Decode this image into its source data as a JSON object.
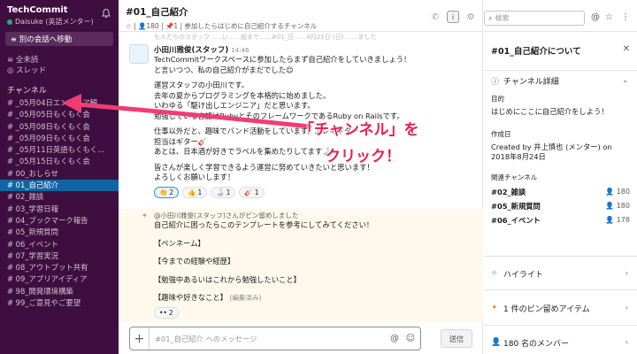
{
  "workspace": {
    "name": "TechCommit",
    "user": "Daisuke (英語メンター)"
  },
  "sidebar": {
    "jump_label": "別の会話へ移動",
    "nav": [
      "全未読",
      "スレッド"
    ],
    "section_title": "チャンネル",
    "channels": [
      "# _05月04日エンジニア観...",
      "# _05月05日もくもく会",
      "# _05月08日もくもく会",
      "# _05月09日もくもく会",
      "# _05月11日英語もくもく...",
      "# _05月15日もくもく会",
      "# 00_おしらせ",
      "# 01_自己紹介",
      "# 02_雑談",
      "# 03_学習日報",
      "# 04_ブックマーク報告",
      "# 05_新規質問",
      "# 06_イベント",
      "# 07_学習実況",
      "# 08_アウトプット共有",
      "# 09_アプリアイディア",
      "# 98_開発環境構築",
      "# 99_ご意見やご要望"
    ]
  },
  "channel": {
    "title": "#01_自己紹介",
    "members": "180",
    "pins": "1",
    "topic": "参加したらはじめに自己紹介するチャンネル"
  },
  "messages": {
    "cut_line": "も人たちのスタッフ……い……組まで……#01_日……4月21日 (日) ……ました",
    "first": {
      "author": "小田川雅俊(スタッフ)",
      "time": "14:46",
      "lines": [
        "TechCommitワークスペースに参加したらまず自己紹介をしていきましょう！",
        "と言いつつ、私の自己紹介がまだでした😊",
        "",
        "運営スタッフの小田川です。",
        "去年の夏からプログラミングを本格的に始めました。",
        "いわゆる「駆け出しエンジニア」だと思います。",
        "勉強している言語はRubyとそのフレームワークであるRuby on Railsです。",
        "",
        "仕事以外だと、趣味でバンド活動をしています。エレキギター",
        "担当はギター🎸",
        "あとは、日本酒が好きでラベルを集めたりしてます🍶",
        "",
        "皆さんが楽しく学習できるよう運営に努めていきたいと思います！",
        "よろしくお願いします！"
      ],
      "reactions": [
        {
          "emoji": "👏",
          "count": "2"
        },
        {
          "emoji": "👍",
          "count": "1"
        },
        {
          "emoji": "🍶",
          "count": "1"
        },
        {
          "emoji": "🎸",
          "count": "1"
        }
      ]
    },
    "pinned": {
      "note": "@小田川雅俊(スタッフ)さんがピン留めしました",
      "intro": "自己紹介に困ったらこのテンプレートを参考にしてみてください！",
      "items": [
        "【ペンネーム】",
        "【今までの経験や経歴】",
        "【勉強中あるいはこれから勉強したいこと】",
        "【趣味や好きなこと】"
      ],
      "edited": "(編集済み)",
      "reaction": "2"
    }
  },
  "composer": {
    "placeholder": "#01_自己紹介 へのメッセージ",
    "send_label": "送信"
  },
  "right_pane": {
    "search_placeholder": "検索",
    "details_title": "#01_自己紹介について",
    "channel_details_title": "チャンネル詳細",
    "purpose_label": "目的",
    "purpose_value": "はじめにここに自己紹介をしよう！",
    "created_label": "作成日",
    "created_value_1": "Created by 井上慎也 (メンター) on",
    "created_value_2": "2018年8月24日",
    "related_label": "関連チャンネル",
    "related": [
      {
        "name": "#02_雑談",
        "count": "180"
      },
      {
        "name": "#05_新規質問",
        "count": "180"
      },
      {
        "name": "#06_イベント",
        "count": "178"
      }
    ],
    "highlights": "ハイライト",
    "pinned_items": "1 件のピン留めアイテム",
    "members": "180 名のメンバー"
  },
  "annotation": {
    "line1": "「チャンネル」を",
    "line2": "クリック！",
    "color": "#e8204f"
  }
}
